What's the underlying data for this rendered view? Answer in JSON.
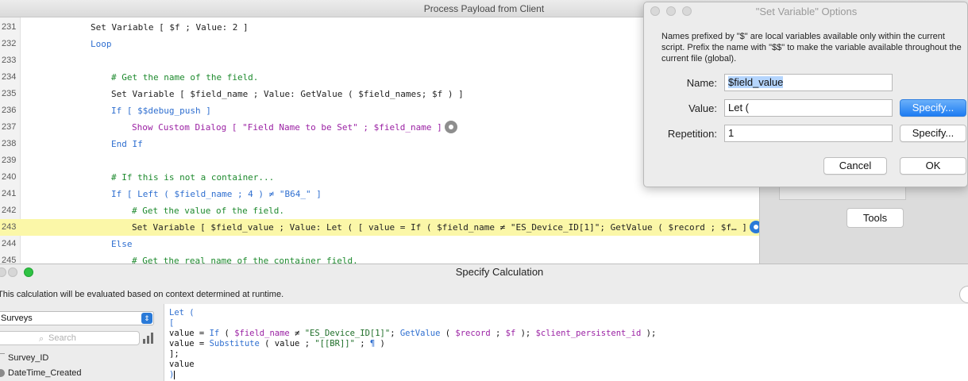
{
  "editor": {
    "title": "Process Payload from Client",
    "lines": [
      {
        "num": "231",
        "text": "Set Variable [ $f ; Value: 2 ]",
        "indent": 1
      },
      {
        "num": "232",
        "text": "Loop",
        "indent": 1
      },
      {
        "num": "233",
        "text": "",
        "indent": 1
      },
      {
        "num": "234",
        "text": "# Get the name of the field.",
        "indent": 2
      },
      {
        "num": "235",
        "text": "Set Variable [ $field_name ; Value: GetValue ( $field_names; $f ) ]",
        "indent": 2
      },
      {
        "num": "236",
        "text": "If [ $$debug_push ]",
        "indent": 2
      },
      {
        "num": "237",
        "text": "Show Custom Dialog [ \"Field Name to be Set\" ; $field_name ]",
        "indent": 3
      },
      {
        "num": "238",
        "text": "End If",
        "indent": 2
      },
      {
        "num": "239",
        "text": "",
        "indent": 2
      },
      {
        "num": "240",
        "text": "# If this is not a container...",
        "indent": 2
      },
      {
        "num": "241",
        "text": "If [ Left ( $field_name ; 4 ) ≠ \"B64_\" ]",
        "indent": 2
      },
      {
        "num": "242",
        "text": "# Get the value of the field.",
        "indent": 3
      },
      {
        "num": "243",
        "text": "Set Variable [ $field_value ; Value: Let ( [ value = If ( $field_name ≠ \"ES_Device_ID[1]\"; GetValue ( $record ; $f… ]",
        "indent": 3
      },
      {
        "num": "244",
        "text": "Else",
        "indent": 2
      },
      {
        "num": "245",
        "text": "# Get the real name of the container field.",
        "indent": 3
      }
    ],
    "colors": {
      "step": "#222222",
      "control": "#2f6fd0",
      "comment": "#1e8a2e",
      "dialog": "#9b22a4",
      "highlight": "#fbf7a8"
    }
  },
  "tools_label": "Tools",
  "set_variable": {
    "title": "\"Set Variable\" Options",
    "description": "Names prefixed by \"$\" are local variables available only within the current script. Prefix the name with \"$$\" to make the variable available throughout the current file (global).",
    "name_label": "Name:",
    "name_value": "$field_value",
    "value_label": "Value:",
    "value_value": "Let (",
    "repetition_label": "Repetition:",
    "repetition_value": "1",
    "specify_label": "Specify...",
    "specify_label_2": "Specify...",
    "cancel_label": "Cancel",
    "ok_label": "OK"
  },
  "calc": {
    "title": "Specify Calculation",
    "info": "This calculation will be evaluated based on context determined at runtime.",
    "table": "Surveys",
    "search_placeholder": "Search",
    "fields": [
      "Survey_ID",
      "DateTime_Created"
    ],
    "code": [
      "Let (",
      "[",
      "value = If ( $field_name ≠ \"ES_Device_ID[1]\"; GetValue ( $record ; $f ); $client_persistent_id );",
      "value = Substitute ( value ; \"[[BR]]\" ; ¶ )",
      "];",
      "value",
      ")"
    ]
  },
  "icons": [
    "gear-icon",
    "search-icon",
    "chevron-updown-icon",
    "field-list-icon",
    "help-icon"
  ]
}
